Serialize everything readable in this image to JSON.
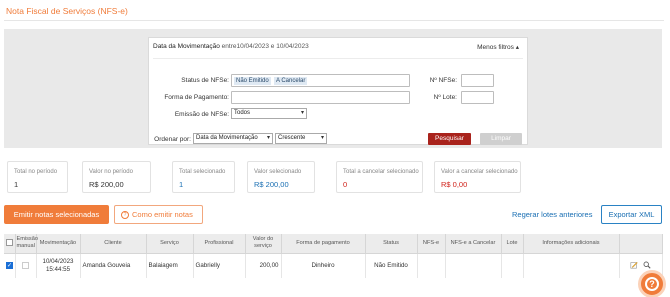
{
  "page": {
    "title": "Nota Fiscal de Serviços (NFS-e)"
  },
  "filters": {
    "period_label": "Data da Movimentação",
    "period_text": "entre10/04/2023  e 10/04/2023",
    "less_filters": "Menos filtros",
    "status_label": "Status de NFSe:",
    "status_chips": [
      "Não Emitido",
      "A Cancelar"
    ],
    "payment_label": "Forma de Pagamento:",
    "payment_value": "",
    "emission_label": "Emissão de NFSe:",
    "emission_value": "Todos",
    "nfse_number_label": "Nº NFSe:",
    "nfse_number_value": "",
    "lot_label": "Nº Lote:",
    "lot_value": "",
    "order_label": "Ordenar por:",
    "order_by_value": "Data da Movimentação",
    "order_dir_value": "Crescente",
    "search_button": "Pesquisar",
    "clear_button": "Limpar"
  },
  "stats": [
    {
      "title": "Total no período",
      "value": "1",
      "color": "#333333"
    },
    {
      "title": "Valor no período",
      "value": "R$ 200,00",
      "color": "#333333"
    },
    {
      "title": "Total selecionado",
      "value": "1",
      "color": "#1a6fb3"
    },
    {
      "title": "Valor selecionado",
      "value": "R$ 200,00",
      "color": "#1a6fb3"
    },
    {
      "title": "Total a cancelar selecionado",
      "value": "0",
      "color": "#d0221a"
    },
    {
      "title": "Valor a cancelar selecionado",
      "value": "R$ 0,00",
      "color": "#d0221a"
    }
  ],
  "actions": {
    "emit_selected": "Emitir notas selecionadas",
    "how_to_emit": "Como emitir notas",
    "register_lots": "Regerar lotes anteriores",
    "export_xml": "Exportar XML"
  },
  "table": {
    "headers": [
      "Emissão manual",
      "Movimentação",
      "Cliente",
      "Serviço",
      "Profissional",
      "Valor do serviço",
      "Forma de pagamento",
      "Status",
      "NFS-e",
      "NFS-e a Cancelar",
      "Lote",
      "Informações adicionais"
    ],
    "rows": [
      {
        "selected": true,
        "manual": false,
        "movement": "10/04/2023 15:44:55",
        "client": "Amanda Gouveia",
        "service": "Balaiagem",
        "professional": "Gabrielly",
        "value": "200,00",
        "payment": "Dinheiro",
        "status": "Não Emitido",
        "nfse": "",
        "nfse_cancel": "",
        "lot": "",
        "info": ""
      }
    ]
  },
  "colors": {
    "accent": "#f07c3a",
    "primary_blue": "#1a6fb3",
    "danger": "#d0221a",
    "search_button": "#a9231c"
  }
}
